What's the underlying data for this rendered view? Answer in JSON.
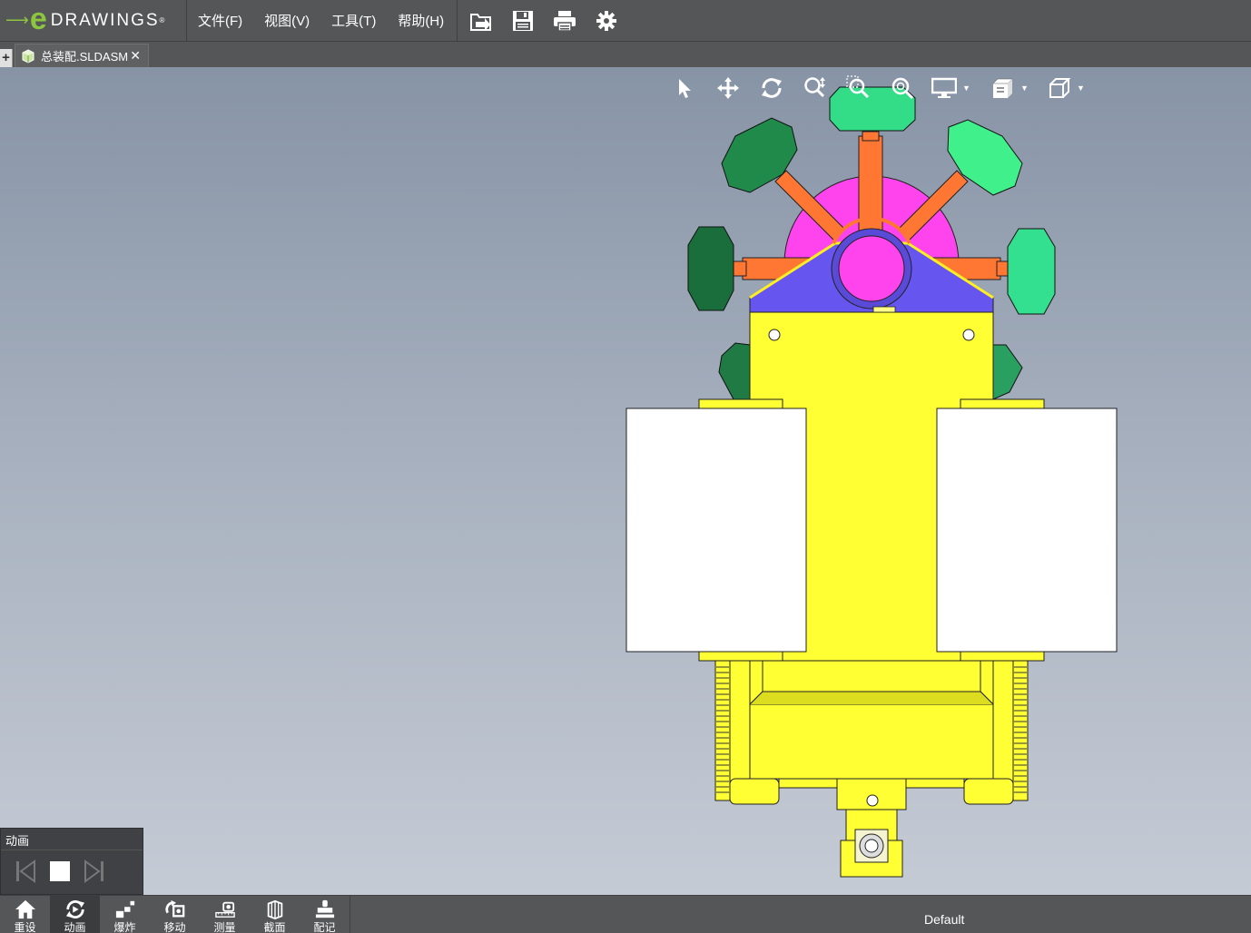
{
  "app": {
    "logo_text": "DRAWINGS",
    "logo_letter": "e",
    "logo_reg": "®"
  },
  "menu": {
    "items": [
      {
        "label": "文件(F)"
      },
      {
        "label": "视图(V)"
      },
      {
        "label": "工具(T)"
      },
      {
        "label": "帮助(H)"
      }
    ]
  },
  "top_tools": [
    "open-icon",
    "save-icon",
    "print-icon",
    "settings-icon"
  ],
  "tabs": {
    "add_label": "+",
    "document": {
      "label": "总装配.SLDASM",
      "close_label": "✕"
    }
  },
  "view_tools": [
    "select-icon",
    "pan-icon",
    "rotate-icon",
    "zoom-icon",
    "zoom-to-area-icon",
    "zoom-to-fit-icon",
    "display-style-icon",
    "view-orientation-icon",
    "standard-views-icon"
  ],
  "animation": {
    "title": "动画"
  },
  "bottom_toolbar": {
    "items": [
      {
        "label": "重设",
        "icon": "home-icon"
      },
      {
        "label": "动画",
        "icon": "animate-icon"
      },
      {
        "label": "爆炸",
        "icon": "explode-icon"
      },
      {
        "label": "移动",
        "icon": "move-icon"
      },
      {
        "label": "测量",
        "icon": "measure-icon"
      },
      {
        "label": "截面",
        "icon": "section-icon"
      },
      {
        "label": "配记",
        "icon": "markup-icon"
      }
    ],
    "configuration": "Default"
  },
  "colors": {
    "toolbar_bg": "#545658",
    "brand_green": "#8cc63f",
    "model_yellow": "#ffff33",
    "model_orange": "#ff7733",
    "model_magenta": "#ff44ee",
    "model_purple": "#6655ee",
    "model_dark_green": "#1f8a4a",
    "model_light_green": "#33ee88"
  }
}
